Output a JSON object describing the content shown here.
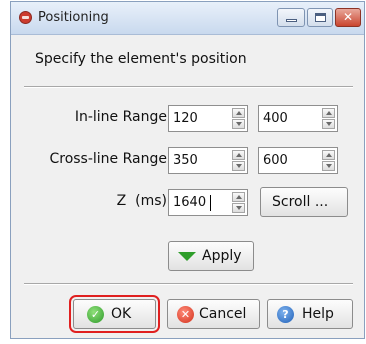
{
  "window": {
    "title": "Positioning"
  },
  "instruction": "Specify the element's position",
  "fields": {
    "inline": {
      "label": "In-line Range",
      "from": "120",
      "to": "400"
    },
    "crossline": {
      "label": "Cross-line Range",
      "from": "350",
      "to": "600"
    },
    "z": {
      "label": "Z  (ms)",
      "value": "1640"
    }
  },
  "buttons": {
    "scroll": "Scroll ...",
    "apply": "Apply",
    "ok": "OK",
    "cancel": "Cancel",
    "help": "Help"
  },
  "icons": {
    "app": "positioning-app-icon",
    "ok": "check-icon",
    "cancel": "x-circle-icon",
    "help": "question-icon",
    "apply": "down-triangle-icon"
  },
  "colors": {
    "ok_highlight": "#e02020"
  }
}
